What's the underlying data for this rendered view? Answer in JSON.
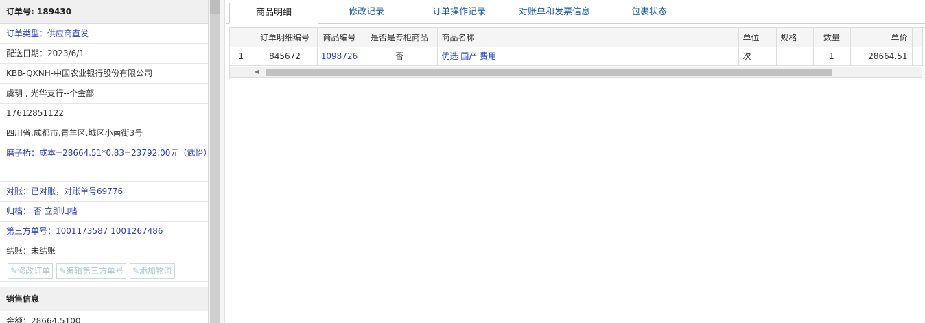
{
  "order": {
    "number_label": "订单号:",
    "number": "189430",
    "type": "订单类型：供应商直发",
    "delivery_date": "配送日期：2023/6/1",
    "company": "KBB-QXNH-中国农业银行股份有限公司",
    "branch": "虞玥 , 光华支行--个金部",
    "phone": "17612851122",
    "address": "四川省.成都市.青羊区.城区小南街3号",
    "cost_line": "磨子桥：成本=28664.51*0.83=23792.00元（武怡）",
    "reconcile": "对账：已对账，对账单号69776",
    "archive_label": "归档：",
    "archive_value": "否 立即归档",
    "third_party": "第三方单号：1001173587 1001267486",
    "settlement": "结账：未结账"
  },
  "buttons": {
    "edit_order": "修改订单",
    "edit_third_party": "编辑第三方单号",
    "add_logistics": "添加物流"
  },
  "sales": {
    "title": "销售信息",
    "amount": "金额：28664.5100"
  },
  "tabs": [
    "商品明细",
    "修改记录",
    "订单操作记录",
    "对账单和发票信息",
    "包裹状态"
  ],
  "table": {
    "columns": [
      "",
      "订单明细编号",
      "商品编号",
      "是否是专柜商品",
      "商品名称",
      "单位",
      "规格",
      "数量",
      "单价"
    ],
    "rows": [
      [
        "1",
        "845672",
        "1098726",
        "否",
        "优选 国产 费用",
        "次",
        "",
        "1",
        "28664.51"
      ]
    ]
  },
  "icons": {
    "edit": "edit-icon",
    "scroll_left": "chevron-left-icon"
  }
}
